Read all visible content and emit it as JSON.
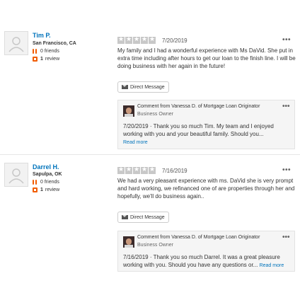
{
  "reviews": [
    {
      "user": {
        "name": "Tim P.",
        "location": "San Francisco, CA",
        "friends": "0",
        "friends_label": "friends",
        "reviews": "1",
        "reviews_label": "review"
      },
      "rating": 5,
      "date": "7/20/2019",
      "more": "•••",
      "text": "My family and I had a wonderful experience with Ms DaVid. She put in extra time including after hours to get our loan to the finish line. I will be doing business with her again in the future!",
      "dm_label": "Direct Message",
      "comment": {
        "title": "Comment from Vanessa D. of Mortgage Loan Originator",
        "role": "Business Owner",
        "date": "7/20/2019",
        "sep": "·",
        "text": "Thank you so much Tim. My team and I enjoyed working with you and your beautiful family. Should you...",
        "read_more": "Read more",
        "more": "•••"
      }
    },
    {
      "user": {
        "name": "Darrel H.",
        "location": "Sapulpa, OK",
        "friends": "0",
        "friends_label": "friends",
        "reviews": "1",
        "reviews_label": "review"
      },
      "rating": 5,
      "date": "7/16/2019",
      "more": "•••",
      "text": "We had a very pleasant experience with ms. DaVid she is very prompt and hard working, we refinanced one of are properties through her and hopefully, we'll do business again..",
      "dm_label": "Direct Message",
      "comment": {
        "title": "Comment from Vanessa D. of Mortgage Loan Originator",
        "role": "Business Owner",
        "date": "7/16/2019",
        "sep": "·",
        "text": "Thank you so much Darrel. It was a great pleasure working with you. Should you have any questions or...",
        "read_more": "Read more",
        "more": "•••"
      }
    }
  ],
  "colors": {
    "link": "#0073bb",
    "accent": "#f15c00",
    "star_empty": "#c8c8c8"
  },
  "icons": [
    "user-placeholder-icon",
    "friends-icon",
    "review-icon",
    "star-icon",
    "envelope-icon",
    "more-icon"
  ]
}
